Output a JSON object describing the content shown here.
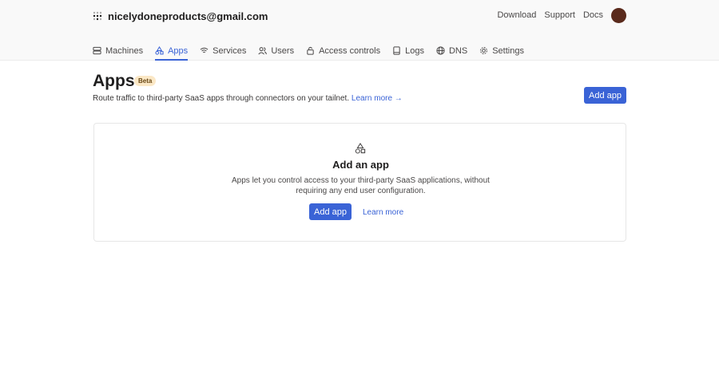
{
  "account": {
    "email": "nicelydoneproducts@gmail.com"
  },
  "toplinks": {
    "download": "Download",
    "support": "Support",
    "docs": "Docs"
  },
  "nav": {
    "items": [
      {
        "label": "Machines",
        "icon": "server-icon"
      },
      {
        "label": "Apps",
        "icon": "apps-icon"
      },
      {
        "label": "Services",
        "icon": "wifi-icon"
      },
      {
        "label": "Users",
        "icon": "users-icon"
      },
      {
        "label": "Access controls",
        "icon": "lock-icon"
      },
      {
        "label": "Logs",
        "icon": "book-icon"
      },
      {
        "label": "DNS",
        "icon": "globe-icon"
      },
      {
        "label": "Settings",
        "icon": "gear-icon"
      }
    ],
    "active_index": 1
  },
  "page": {
    "title": "Apps",
    "badge": "Beta",
    "subtitle": "Route traffic to third-party SaaS apps through connectors on your tailnet.",
    "learn_more": "Learn more →",
    "add_app": "Add app"
  },
  "empty_state": {
    "icon": "apps-icon",
    "heading": "Add an app",
    "description": "Apps let you control access to your third-party SaaS applications, without requiring any end user configuration.",
    "add_app": "Add app",
    "learn_more": "Learn more"
  },
  "colors": {
    "accent": "#3a63d6",
    "badge_bg": "#fbe8c6",
    "avatar": "#5a2a1c"
  }
}
